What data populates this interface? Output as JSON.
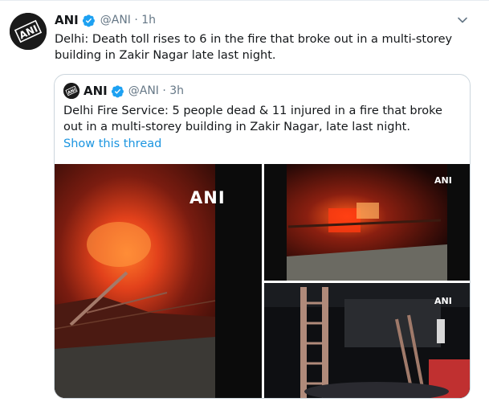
{
  "tweet": {
    "avatar_text": "ANI",
    "name": "ANI",
    "handle_time": "@ANI · 1h",
    "text": "Delhi: Death toll rises to 6 in the fire that broke out in a multi-storey building in Zakir Nagar late last night."
  },
  "quote": {
    "avatar_text": "ANI",
    "name": "ANI",
    "handle_time": "@ANI · 3h",
    "text": "Delhi Fire Service: 5 people dead & 11 injured in a fire that broke out in a multi-storey building in Zakir Nagar, late last night.",
    "show_thread": "Show this thread",
    "media": [
      {
        "watermark": "ANI"
      },
      {
        "watermark": "ANI"
      },
      {
        "watermark": "ANI"
      }
    ]
  },
  "colors": {
    "link": "#1b95e0",
    "verified": "#1da1f2",
    "secondary_text": "#657786",
    "border": "#ccd6dd"
  },
  "icons": {
    "verified": "verified-badge-icon",
    "caret": "chevron-down-icon"
  }
}
